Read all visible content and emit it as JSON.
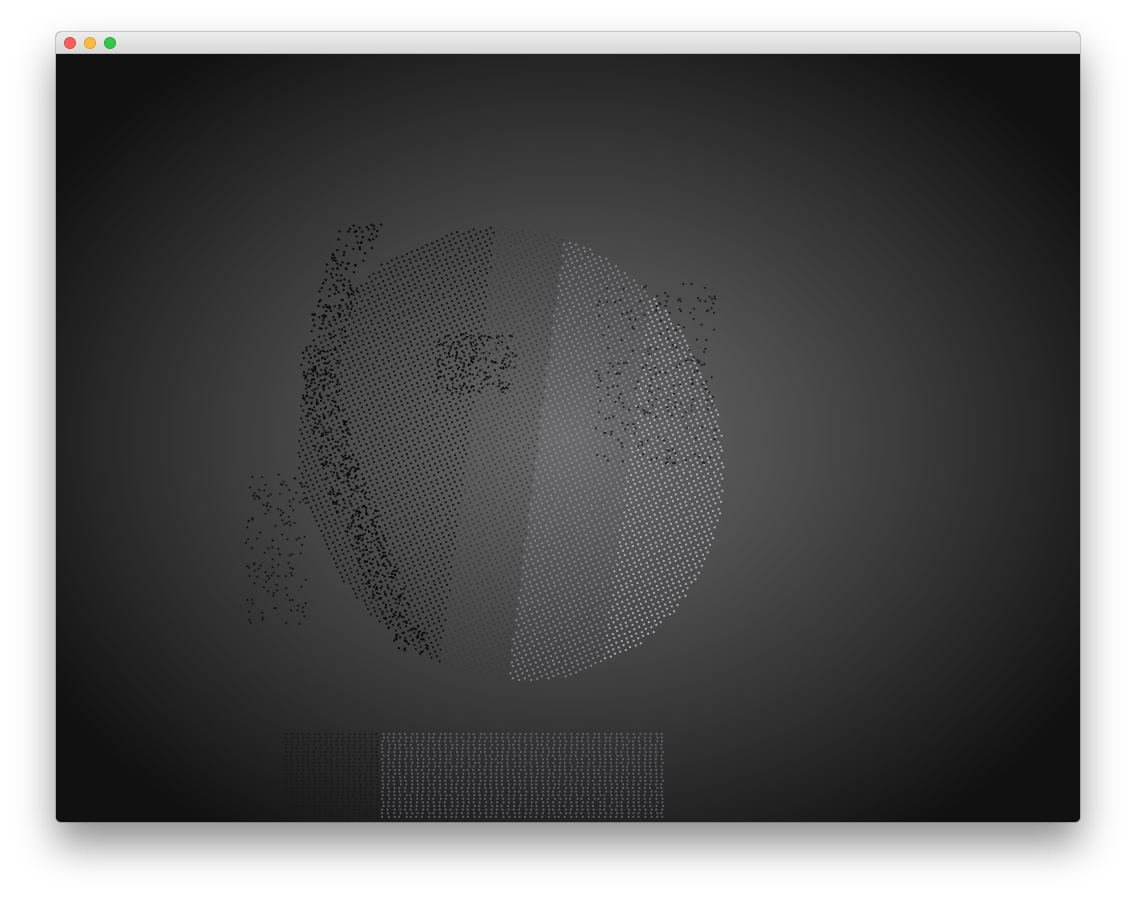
{
  "window": {
    "title": "",
    "controls": {
      "close": "close-button",
      "minimize": "minimize-button",
      "zoom": "zoom-button"
    }
  },
  "viewport": {
    "content": "point-cloud",
    "background_center_color": "#6a6a6a",
    "background_edge_color": "#111111"
  }
}
